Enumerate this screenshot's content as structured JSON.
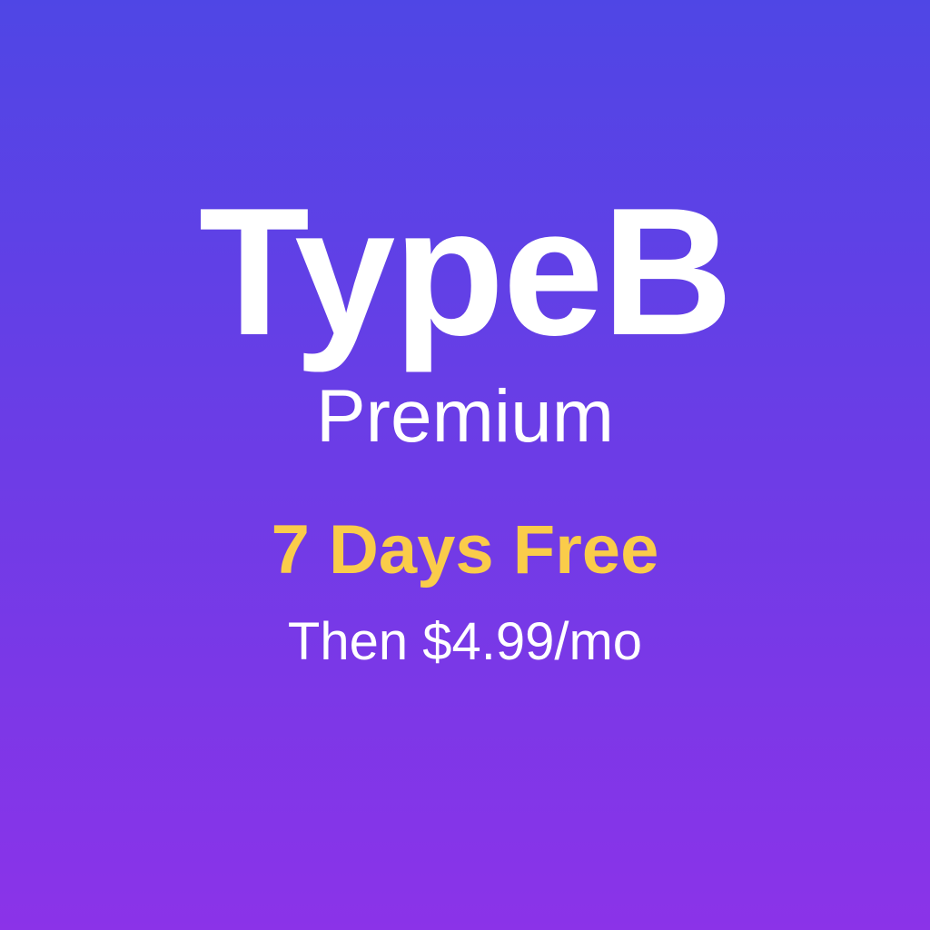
{
  "promo": {
    "app_name": "TypeB",
    "tier": "Premium",
    "trial_offer": "7 Days Free",
    "price_note": "Then $4.99/mo"
  },
  "colors": {
    "background_top": "#4F46E5",
    "background_bottom": "#8B33E8",
    "text_primary": "#FFFFFF",
    "accent": "#FACC4A"
  }
}
